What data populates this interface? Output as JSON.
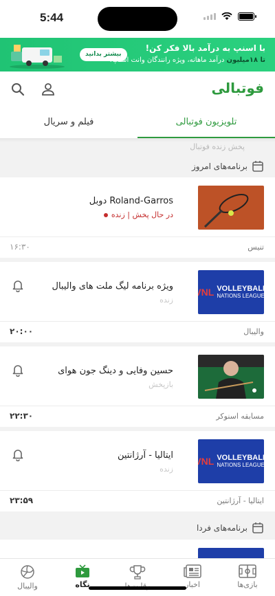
{
  "status_bar": {
    "time": "5:44"
  },
  "ad": {
    "title": "با اسنپ به درآمد بالا فکر کن!",
    "subtitle_prefix": "تا ۱۸میلیون",
    "subtitle_rest": " درآمد ماهانه، ویژه رانندگان وانت اسنپ!",
    "button": "بیشتر بدانید"
  },
  "header": {
    "logo": "فوتبالی",
    "icons": [
      "user-icon",
      "search-icon"
    ]
  },
  "tabs": [
    {
      "label": "تلویزیون فوتبالی",
      "active": true
    },
    {
      "label": "فیلم و سریال",
      "active": false
    }
  ],
  "section_label": "پخش زنده فوتبال",
  "days": {
    "today": "برنامه‌های امروز",
    "tomorrow": "برنامه‌های فردا"
  },
  "programs": [
    {
      "title": "دوبل Roland-Garros",
      "status": "در حال پخش | زنده",
      "status_type": "live",
      "time": "۱۶:۳۰",
      "category": "تنیس",
      "thumb": "tennis",
      "bell": false
    },
    {
      "title": "ویژه برنامه لیگ ملت های والیبال",
      "status": "زنده",
      "status_type": "normal",
      "time": "۲۰:۰۰",
      "category": "والیبال",
      "thumb": "vnl",
      "bell": true
    },
    {
      "title": "حسین وفایی و دینگ جون هوای",
      "status": "بازپخش",
      "status_type": "normal",
      "time": "۲۲:۳۰",
      "category": "مسابقه اسنوکر",
      "thumb": "snooker",
      "bell": true
    },
    {
      "title": "ایتالیا - آرژانتین",
      "status": "زنده",
      "status_type": "normal",
      "time": "۲۳:۵۹",
      "category": "ایتالیا - آرژانتین",
      "thumb": "vnl",
      "bell": true
    }
  ],
  "vnl_logo": {
    "mark": "VNL",
    "line1": "VOLLEYBALL",
    "line2": "NATIONS LEAGUE"
  },
  "bottom_nav": [
    {
      "label": "بازی‌ها",
      "icon": "pitch-icon",
      "active": false
    },
    {
      "label": "اخبار",
      "icon": "newspaper-icon",
      "active": false
    },
    {
      "label": "رقابت‌ها",
      "icon": "trophy-icon",
      "active": false
    },
    {
      "label": "نگاه",
      "icon": "tv-icon",
      "active": true
    },
    {
      "label": "والیبال",
      "icon": "volleyball-icon",
      "active": false
    }
  ],
  "colors": {
    "brand_green": "#2e9a3e",
    "live_red": "#c42c2c",
    "ad_green": "#20c374",
    "vnl_blue": "#1e3ea8"
  }
}
